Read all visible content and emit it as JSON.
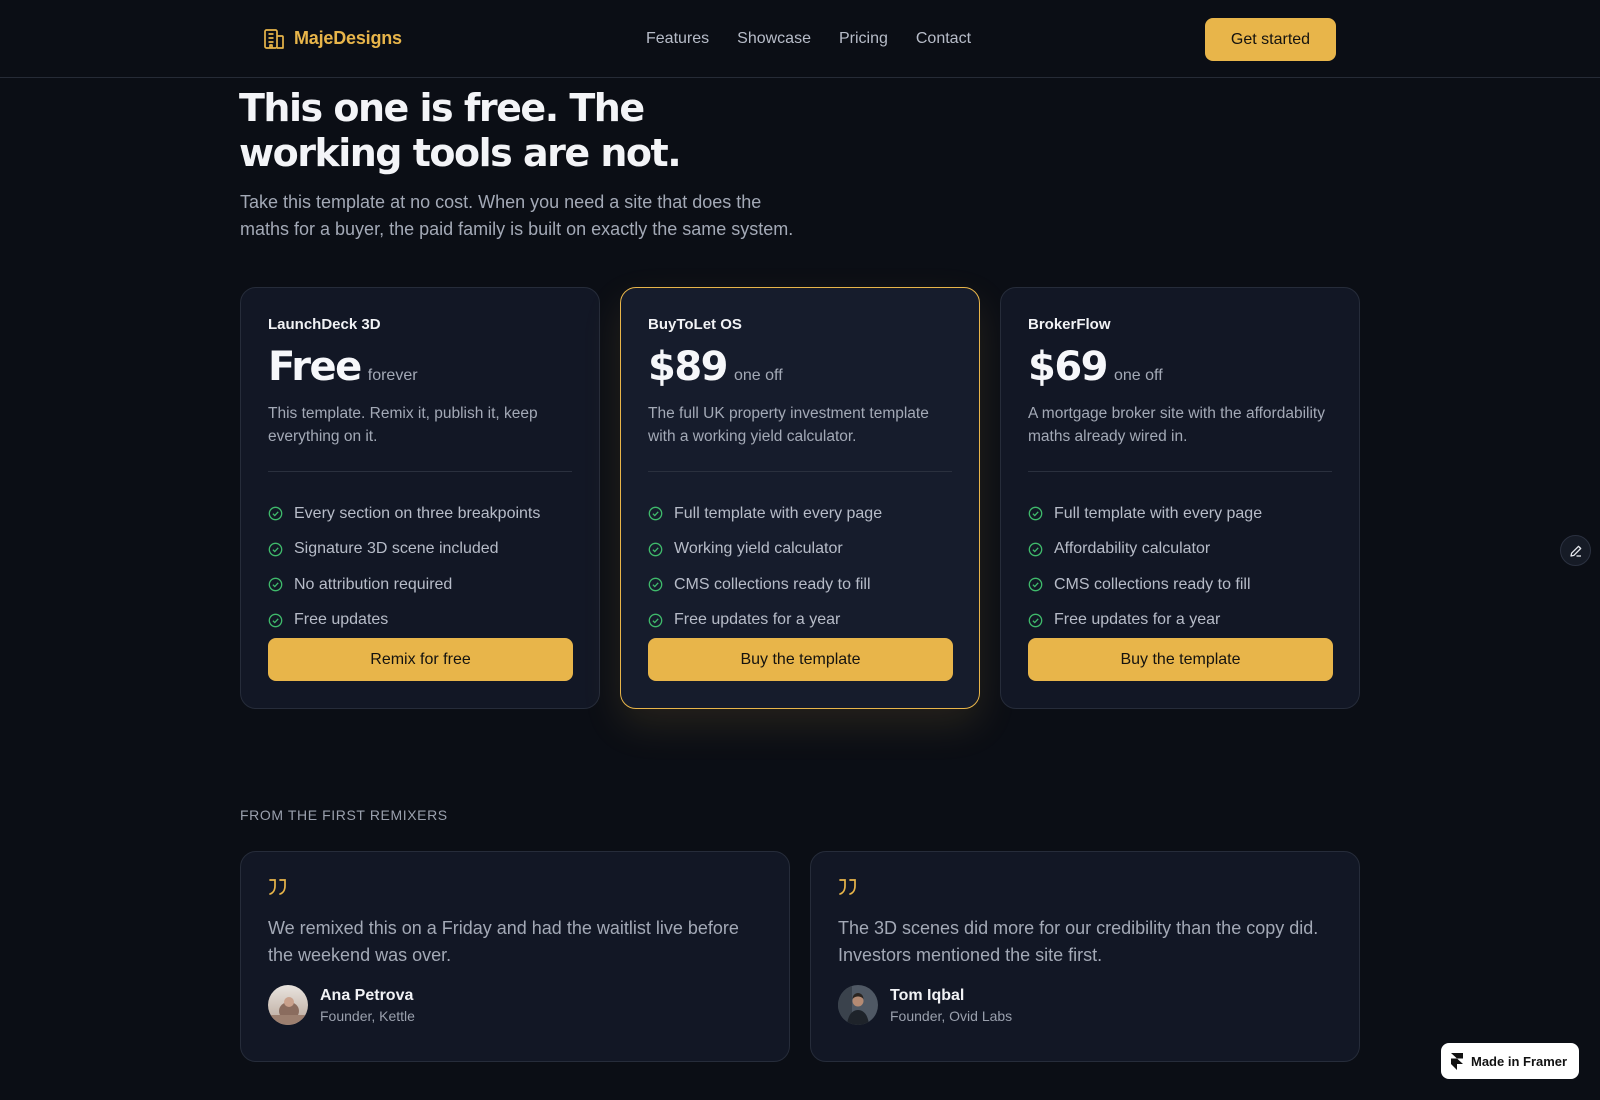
{
  "brand": {
    "name": "MajeDesigns",
    "accent": "#e8b54a"
  },
  "nav": {
    "links": [
      "Features",
      "Showcase",
      "Pricing",
      "Contact"
    ],
    "cta": "Get started"
  },
  "hero": {
    "title_line1": "This one is free. The",
    "title_line2": "working tools are not.",
    "subtitle_line1": "Take this template at no cost. When you need a site that does the",
    "subtitle_line2": "maths for a buyer, the paid family is built on exactly the same system."
  },
  "plans": [
    {
      "name": "LaunchDeck 3D",
      "price": "Free",
      "period": "forever",
      "description": "This template. Remix it, publish it, keep everything on it.",
      "features": [
        "Every section on three breakpoints",
        "Signature 3D scene included",
        "No attribution required",
        "Free updates"
      ],
      "button": "Remix for free",
      "featured": false
    },
    {
      "name": "BuyToLet OS",
      "price": "$89",
      "period": "one off",
      "description": "The full UK property investment template with a working yield calculator.",
      "features": [
        "Full template with every page",
        "Working yield calculator",
        "CMS collections ready to fill",
        "Free updates for a year"
      ],
      "button": "Buy the template",
      "featured": true
    },
    {
      "name": "BrokerFlow",
      "price": "$69",
      "period": "one off",
      "description": "A mortgage broker site with the affordability maths already wired in.",
      "features": [
        "Full template with every page",
        "Affordability calculator",
        "CMS collections ready to fill",
        "Free updates for a year"
      ],
      "button": "Buy the template",
      "featured": false
    }
  ],
  "testimonials": {
    "label": "FROM THE FIRST REMIXERS",
    "items": [
      {
        "quote": "We remixed this on a Friday and had the waitlist live before the weekend was over.",
        "name": "Ana Petrova",
        "role": "Founder, Kettle"
      },
      {
        "quote": "The 3D scenes did more for our credibility than the copy did. Investors mentioned the site first.",
        "name": "Tom Iqbal",
        "role": "Founder, Ovid Labs"
      }
    ]
  },
  "badge": {
    "label": "Made in Framer"
  },
  "icons": {
    "brand": "building-icon",
    "check": "check-circle-icon",
    "quote": "quote-icon",
    "edit": "pencil-icon",
    "framer": "framer-icon"
  }
}
